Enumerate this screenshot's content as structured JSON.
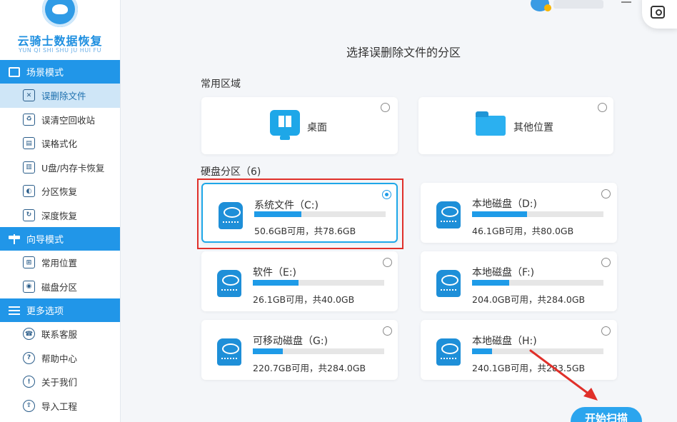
{
  "app": {
    "title": "云骑士数据恢复",
    "subtitle": "YUN QI SHI SHU JU HUI FU"
  },
  "sidebar": {
    "sections": [
      {
        "header": "场景模式",
        "icon": "screen-icon",
        "items": [
          {
            "label": "误删除文件",
            "icon": "deleted-file-icon",
            "active": true
          },
          {
            "label": "误清空回收站",
            "icon": "recycle-bin-icon",
            "active": false
          },
          {
            "label": "误格式化",
            "icon": "format-disk-icon",
            "active": false
          },
          {
            "label": "U盘/内存卡恢复",
            "icon": "usb-card-icon",
            "active": false
          },
          {
            "label": "分区恢复",
            "icon": "partition-icon",
            "active": false
          },
          {
            "label": "深度恢复",
            "icon": "deep-recover-icon",
            "active": false
          }
        ]
      },
      {
        "header": "向导模式",
        "icon": "signpost-icon",
        "items": [
          {
            "label": "常用位置",
            "icon": "common-location-icon",
            "active": false
          },
          {
            "label": "磁盘分区",
            "icon": "disk-partition-icon",
            "active": false
          }
        ]
      },
      {
        "header": "更多选项",
        "icon": "menu-icon",
        "items": [
          {
            "label": "联系客服",
            "icon": "support-icon",
            "active": false
          },
          {
            "label": "帮助中心",
            "icon": "help-icon",
            "active": false
          },
          {
            "label": "关于我们",
            "icon": "info-icon",
            "active": false
          },
          {
            "label": "导入工程",
            "icon": "import-icon",
            "active": false
          }
        ]
      }
    ]
  },
  "main": {
    "title": "选择误删除文件的分区",
    "common_label": "常用区域",
    "common": [
      {
        "name": "桌面",
        "icon": "desktop-windows-icon",
        "selected": false
      },
      {
        "name": "其他位置",
        "icon": "folder-icon",
        "selected": false
      }
    ],
    "partitions_label": "硬盘分区（6)",
    "partitions": [
      {
        "name": "系统文件（C:)",
        "size": "50.6GB可用，共78.6GB",
        "used_fraction": 0.36,
        "selected": true
      },
      {
        "name": "本地磁盘（D:)",
        "size": "46.1GB可用，共80.0GB",
        "used_fraction": 0.42,
        "selected": false
      },
      {
        "name": "软件（E:)",
        "size": "26.1GB可用，共40.0GB",
        "used_fraction": 0.35,
        "selected": false
      },
      {
        "name": "本地磁盘（F:)",
        "size": "204.0GB可用，共284.0GB",
        "used_fraction": 0.28,
        "selected": false
      },
      {
        "name": "可移动磁盘（G:)",
        "size": "220.7GB可用，共284.0GB",
        "used_fraction": 0.23,
        "selected": false
      },
      {
        "name": "本地磁盘（H:)",
        "size": "240.1GB可用，共283.5GB",
        "used_fraction": 0.15,
        "selected": false
      }
    ],
    "start_button": "开始扫描"
  },
  "colors": {
    "accent": "#2196e8",
    "highlight": "#e0302a"
  }
}
